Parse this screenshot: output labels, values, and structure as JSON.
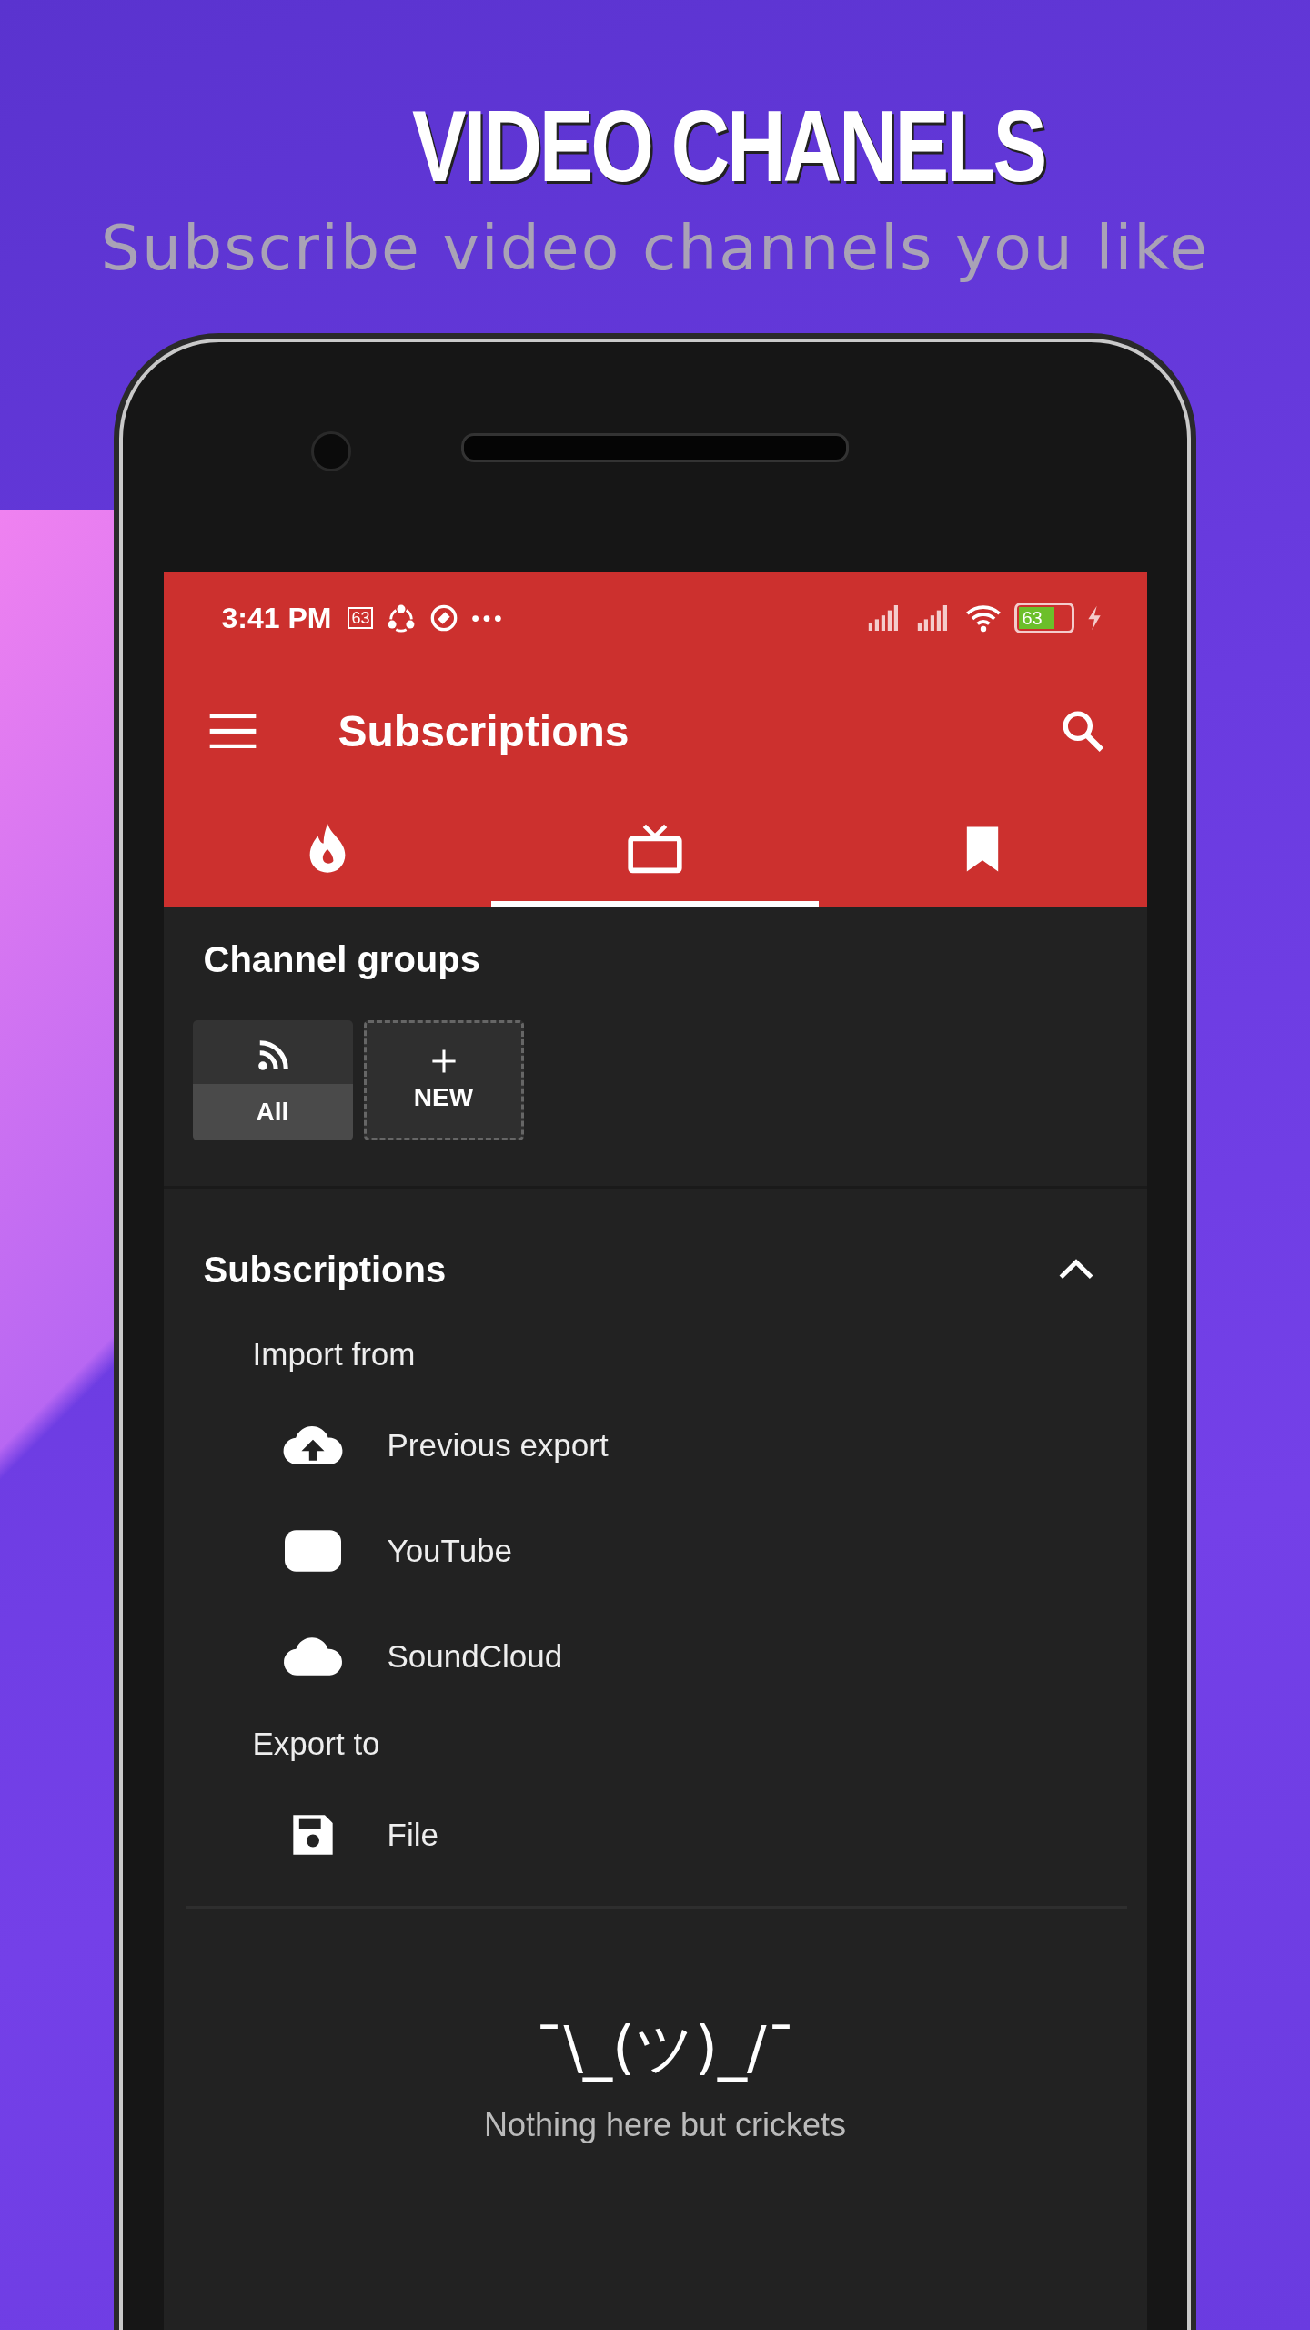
{
  "headline": "VIDEO CHANELS",
  "subtitle": "Subscribe video channels you like",
  "status_bar": {
    "time": "3:41 PM",
    "notification_battery": "63",
    "battery": "63",
    "charging": true
  },
  "toolbar": {
    "title": "Subscriptions"
  },
  "tabs": [
    {
      "kind": "flame",
      "selected": false
    },
    {
      "kind": "tv",
      "selected": true
    },
    {
      "kind": "bookmark",
      "selected": false
    }
  ],
  "channel_groups": {
    "title": "Channel groups",
    "groups": [
      {
        "kind": "all",
        "label": "All"
      },
      {
        "kind": "new",
        "label": "NEW"
      }
    ]
  },
  "subscriptions": {
    "title": "Subscriptions",
    "expanded": true,
    "sections": [
      {
        "heading": "Import from",
        "items": [
          {
            "kind": "upload",
            "label": "Previous export"
          },
          {
            "kind": "youtube",
            "label": "YouTube"
          },
          {
            "kind": "cloud",
            "label": "SoundCloud"
          }
        ]
      },
      {
        "heading": "Export to",
        "items": [
          {
            "kind": "save",
            "label": "File"
          }
        ]
      }
    ]
  },
  "empty_state": {
    "emoticon": "¯\\_(ツ)_/¯",
    "message": "Nothing here but crickets"
  }
}
